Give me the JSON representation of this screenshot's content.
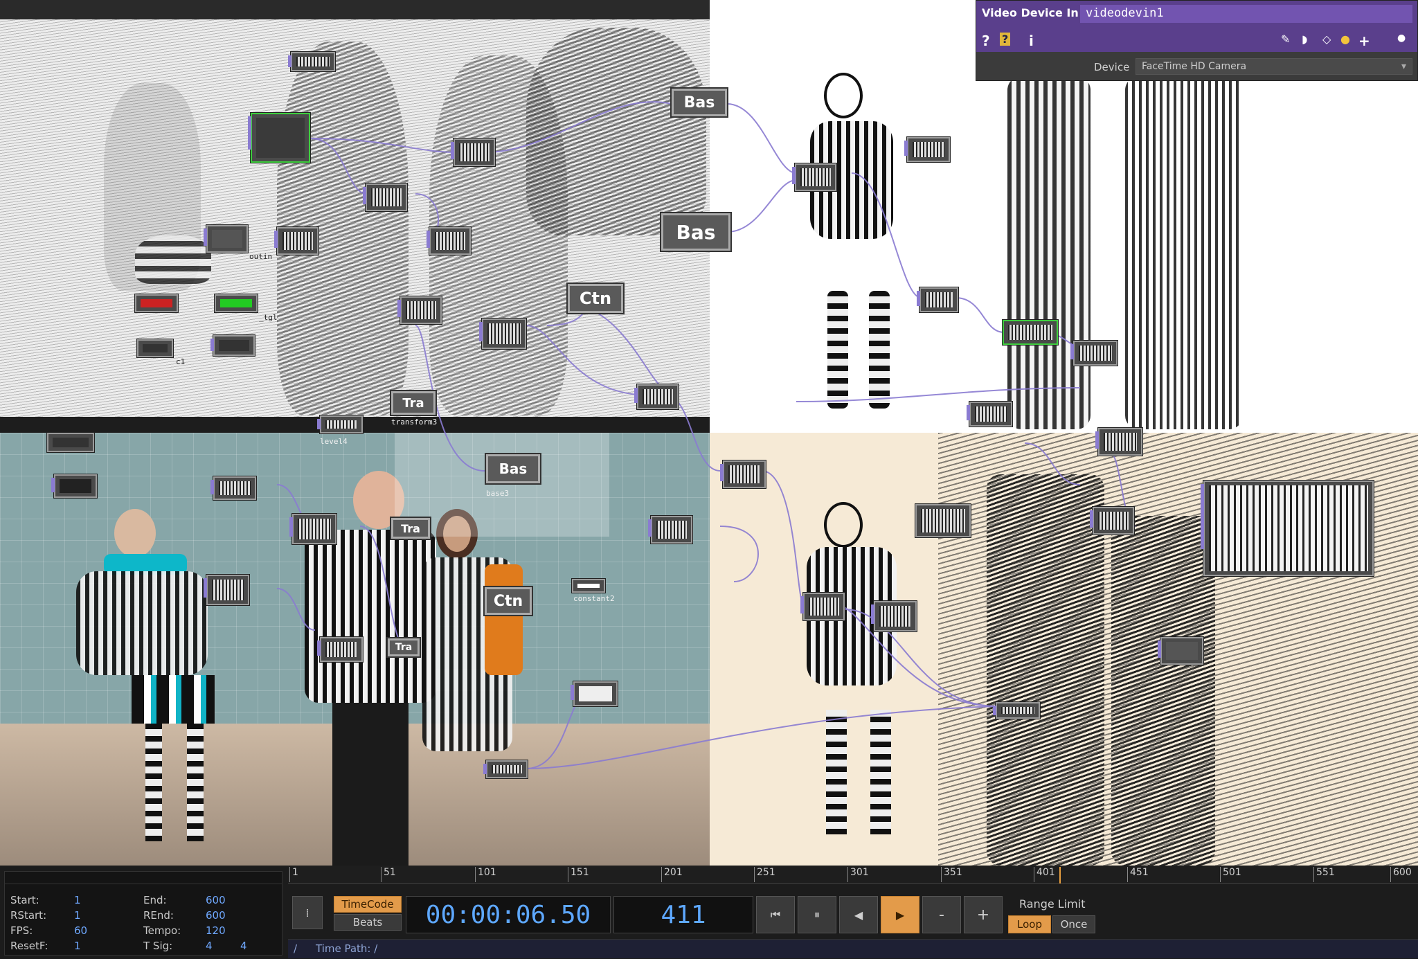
{
  "param_panel": {
    "op_type": "Video Device In",
    "op_name": "videodevin1",
    "device_label": "Device",
    "device_value": "FaceTime HD Camera",
    "icons": [
      "help-icon",
      "python-help-icon",
      "info-icon",
      "edit-icon",
      "comment-icon",
      "clone-icon",
      "python-icon",
      "add-icon",
      "dot-icon"
    ]
  },
  "nodes": {
    "bas1": "Bas",
    "bas2": "Bas",
    "bas3": "Bas",
    "ctn1": "Ctn",
    "ctn2": "Ctn",
    "tra1": "Tra",
    "tra2": "Tra",
    "tra3": "Tra",
    "label_transform3": "transform3",
    "label_level4": "level4",
    "label_base3": "base3",
    "label_constant2": "constant2",
    "label_outin": "outin",
    "label_tgl": "_tgl",
    "label_c1": "c1",
    "label_tgl2": "tgl"
  },
  "info": {
    "start_label": "Start:",
    "start": "1",
    "end_label": "End:",
    "end": "600",
    "rstart_label": "RStart:",
    "rstart": "1",
    "rend_label": "REnd:",
    "rend": "600",
    "fps_label": "FPS:",
    "fps": "60",
    "tempo_label": "Tempo:",
    "tempo": "120",
    "resetf_label": "ResetF:",
    "resetf": "1",
    "tsig_label": "T Sig:",
    "tsig_a": "4",
    "tsig_b": "4"
  },
  "ruler": [
    "1",
    "51",
    "101",
    "151",
    "201",
    "251",
    "301",
    "351",
    "401",
    "451",
    "501",
    "551",
    "600"
  ],
  "transport": {
    "timecode_label": "TimeCode",
    "beats_label": "Beats",
    "timecode": "00:00:06.50",
    "frame": "411",
    "range_limit": "Range Limit",
    "loop": "Loop",
    "once": "Once",
    "minus": "-",
    "plus": "+"
  },
  "path_bar": {
    "slash": "/",
    "time_path": "Time Path: /"
  },
  "colors": {
    "panel_purple": "#5a3f8c",
    "accent_orange": "#e39b4a",
    "lcd_blue": "#5ea8ff",
    "selected_green": "#3ecf3e",
    "wire": "#8a7bd1"
  }
}
